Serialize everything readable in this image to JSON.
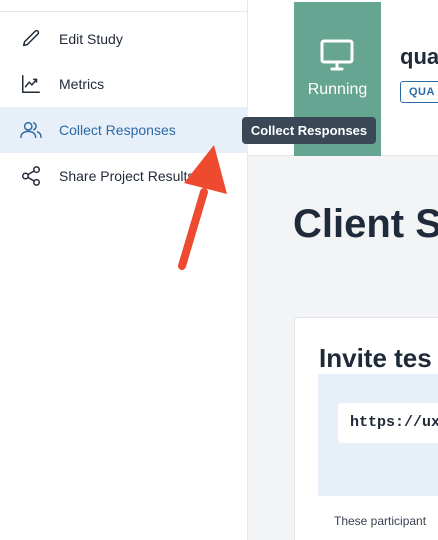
{
  "sidebar": {
    "items": [
      {
        "label": "Edit Study",
        "icon": "pencil-icon"
      },
      {
        "label": "Metrics",
        "icon": "chart-line-icon"
      },
      {
        "label": "Collect Responses",
        "icon": "users-icon",
        "active": true
      },
      {
        "label": "Share Project Results",
        "icon": "share-icon"
      }
    ]
  },
  "tooltip": {
    "text": "Collect Responses"
  },
  "header": {
    "status": {
      "label": "Running",
      "icon": "monitor-icon"
    },
    "study_name": "qua",
    "badge": "QUA"
  },
  "main": {
    "title": "Client S",
    "invite_card": {
      "heading": "Invite tes",
      "link": "https://uxl.a",
      "footnote": "These participant"
    }
  },
  "colors": {
    "accent": "#2c6aa6",
    "status_running": "#66a592",
    "active_bg": "#e7eff8",
    "tooltip_bg": "#3a4756",
    "annotation_arrow": "#ee4a2f"
  }
}
